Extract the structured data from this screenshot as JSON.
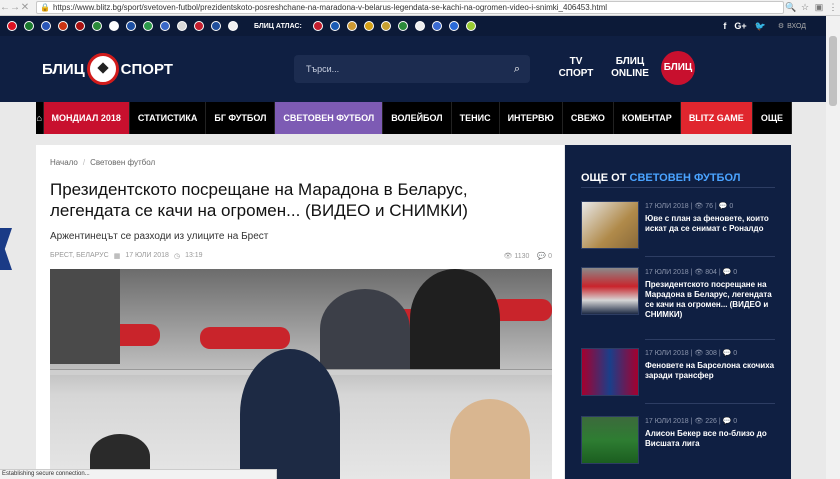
{
  "browser": {
    "url": "https://www.blitz.bg/sport/svetoven-futbol/prezidentskoto-posreshchane-na-maradona-v-belarus-legendata-se-kachi-na-ogromen-video-i-snimki_406453.html",
    "status": "Establishing secure connection..."
  },
  "topbar": {
    "atlas_label": "БЛИЦ АТЛАС:",
    "social": [
      "f",
      "G+",
      "🐦"
    ],
    "login": "ВХОД"
  },
  "header": {
    "logo_left": "БЛИЦ",
    "logo_right": "СПОРТ",
    "search_placeholder": "Търси...",
    "partners": [
      "TV СПОРТ",
      "БЛИЦ ONLINE",
      "БЛИЦ"
    ]
  },
  "nav": {
    "items": [
      {
        "label": "МОНДИАЛ 2018",
        "color": "#c8102e"
      },
      {
        "label": "СТАТИСТИКА",
        "color": "#000000"
      },
      {
        "label": "БГ ФУТБОЛ",
        "color": "#000000"
      },
      {
        "label": "СВЕТОВЕН ФУТБОЛ",
        "color": "#7d5bb4"
      },
      {
        "label": "ВОЛЕЙБОЛ",
        "color": "#000000"
      },
      {
        "label": "ТЕНИС",
        "color": "#000000"
      },
      {
        "label": "ИНТЕРВЮ",
        "color": "#000000"
      },
      {
        "label": "СВЕЖО",
        "color": "#000000"
      },
      {
        "label": "КОМЕНТАР",
        "color": "#000000"
      },
      {
        "label": "BLITZ GAME",
        "color": "#e0262e"
      },
      {
        "label": "ОЩЕ",
        "color": "#000000"
      }
    ]
  },
  "article": {
    "breadcrumb": [
      "Начало",
      "Световен футбол"
    ],
    "title": "Президентското посрещане на Марадона в Беларус, легендата се качи на огромен... (ВИДЕО и СНИМКИ)",
    "lead": "Аржентинецът се разходи из улиците на Брест",
    "tags": "БРЕСТ, БЕЛАРУС",
    "date": "17 ЮЛИ 2018",
    "time": "13:19",
    "views": "1130",
    "comments": "0"
  },
  "sidebar": {
    "head_prefix": "ОЩЕ ОТ",
    "head_accent": "СВЕТОВЕН ФУТБОЛ",
    "articles": [
      {
        "date": "17 ЮЛИ 2018",
        "views": "76",
        "comments": "0",
        "title": "Юве с план за феновете, които искат да се снимат с Роналдо"
      },
      {
        "date": "17 ЮЛИ 2018",
        "views": "804",
        "comments": "0",
        "title": "Президентското посрещане на Марадона в Беларус, легендата се качи на огромен... (ВИДЕО и СНИМКИ)"
      },
      {
        "date": "17 ЮЛИ 2018",
        "views": "308",
        "comments": "0",
        "title": "Феновете на Барселона скочиха заради трансфер"
      },
      {
        "date": "17 ЮЛИ 2018",
        "views": "226",
        "comments": "0",
        "title": "Алисон Бекер все по-близо до Висшата лига"
      }
    ]
  }
}
